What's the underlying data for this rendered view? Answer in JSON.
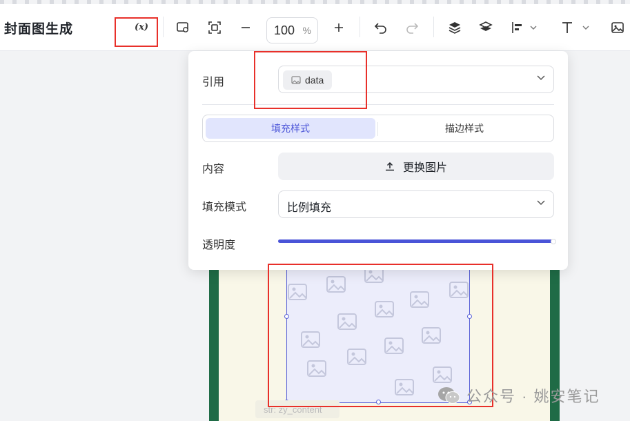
{
  "header": {
    "title": "封面图生成",
    "variable_label": "(x)",
    "zoom_value": "100",
    "zoom_unit": "%"
  },
  "toolbar_icons": [
    "frame-icon",
    "fit-screen-icon",
    "zoom-out-icon",
    "zoom-in-icon",
    "undo-icon",
    "redo-icon",
    "layer-up-icon",
    "layer-down-icon",
    "align-icon",
    "text-icon",
    "image-icon"
  ],
  "panel": {
    "reference": {
      "label": "引用",
      "chip": "data"
    },
    "tabs": [
      {
        "label": "填充样式",
        "active": true
      },
      {
        "label": "描边样式",
        "active": false
      }
    ],
    "content": {
      "label": "内容",
      "button": "更换图片"
    },
    "fill_mode": {
      "label": "填充模式",
      "value": "比例填充"
    },
    "opacity": {
      "label": "透明度",
      "value_fraction": 1.0
    }
  },
  "canvas": {
    "hint": "str: zy_content"
  },
  "watermark": "公众号 · 姚安笔记",
  "colors": {
    "accent": "#4a54d8",
    "highlight": "#e8302a",
    "card_border": "#1f6b46",
    "card_fill": "#f9f7e8"
  }
}
